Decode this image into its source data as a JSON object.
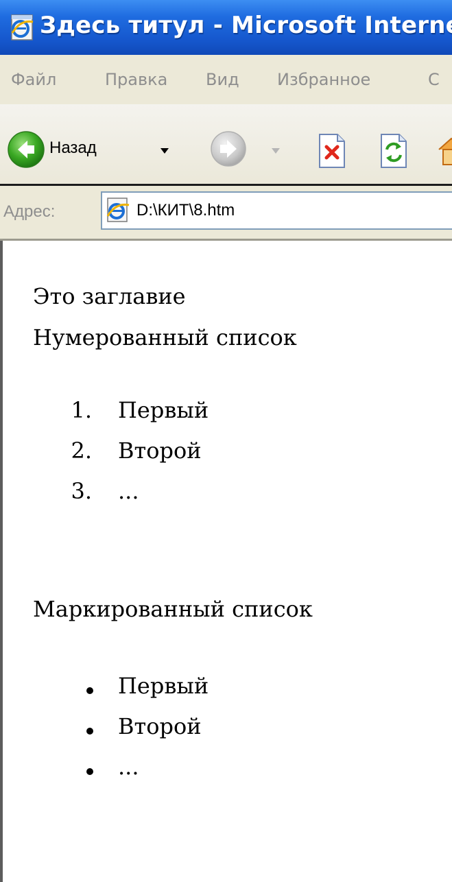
{
  "window": {
    "title": "Здесь титул - Microsoft Interne",
    "icon": "ie-window-icon"
  },
  "menu": {
    "items": [
      "Файл",
      "Правка",
      "Вид",
      "Избранное",
      "С"
    ]
  },
  "toolbar": {
    "back_label": "Назад",
    "back_icon": "back-arrow-icon",
    "forward_icon": "forward-arrow-icon",
    "stop_icon": "stop-icon",
    "refresh_icon": "refresh-icon",
    "home_icon": "home-icon"
  },
  "address": {
    "label": "Адрес:",
    "value": "D:\\КИТ\\8.htm",
    "icon": "ie-page-icon"
  },
  "page": {
    "heading": "Это заглавие",
    "ordered_title": "Нумерованный список",
    "ordered_items": [
      {
        "num": "1.",
        "text": "Первый"
      },
      {
        "num": "2.",
        "text": "Второй"
      },
      {
        "num": "3.",
        "text": "..."
      }
    ],
    "bulleted_title": "Маркированный список",
    "bulleted_items": [
      "Первый",
      "Второй",
      "..."
    ]
  },
  "colors": {
    "titlebar": "#1f6ce0",
    "chrome": "#ece9d8",
    "disabled_text": "#8e8e8e"
  }
}
